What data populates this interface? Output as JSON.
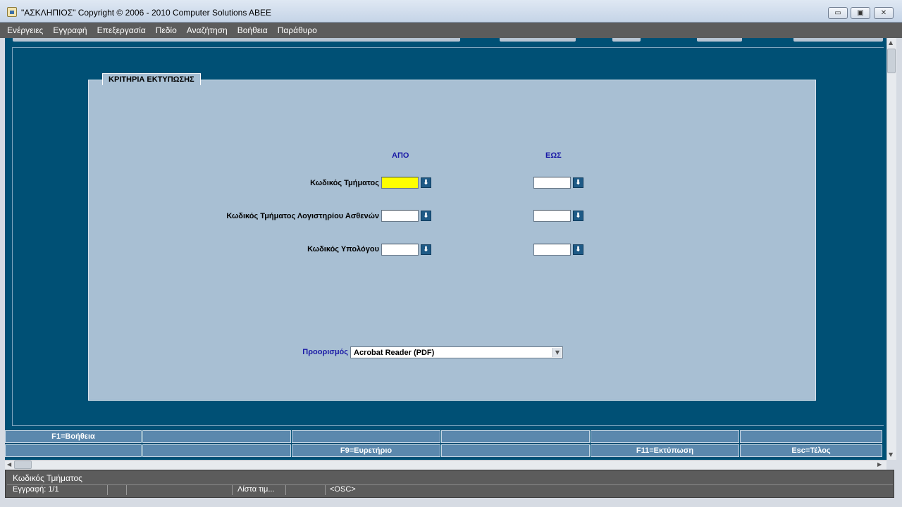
{
  "window": {
    "title": "\"ΑΣΚΛΗΠΙΟΣ\" Copyright © 2006 - 2010 Computer Solutions ABEE",
    "minimize": "▭",
    "maximize": "▣",
    "close": "✕"
  },
  "menu": [
    "Ενέργειες",
    "Εγγραφή",
    "Επεξεργασία",
    "Πεδίο",
    "Αναζήτηση",
    "Βοήθεια",
    "Παράθυρο"
  ],
  "panel": {
    "legend": "ΚΡΙΤΗΡΙΑ ΕΚΤΥΠΩΣΗΣ",
    "col_from": "ΑΠΟ",
    "col_to": "ΕΩΣ",
    "rows": [
      {
        "label": "Κωδικός Τμήματος",
        "from": "",
        "to": ""
      },
      {
        "label": "Κωδικός Τμήματος Λογιστηρίου Ασθενών",
        "from": "",
        "to": ""
      },
      {
        "label": "Κωδικός Υπολόγου",
        "from": "",
        "to": ""
      }
    ],
    "destination_label": "Προορισμός",
    "destination_value": "Acrobat Reader (PDF)"
  },
  "fkeys": {
    "row1": [
      "F1=Βοήθεια",
      "",
      "",
      "",
      "",
      ""
    ],
    "row2": [
      "",
      "",
      "F9=Ευρετήριο",
      "",
      "F11=Εκτύπωση",
      "Esc=Τέλος"
    ]
  },
  "status": {
    "hint": "Κωδικός Τμήματος",
    "record": "Εγγραφή: 1/1",
    "lov": "Λίστα τιμ...",
    "osc": "<OSC>"
  },
  "colors": {
    "background": "#005075",
    "panel": "#a8bfd3",
    "active_field": "#ffff00",
    "fkey": "#5b88ad"
  }
}
